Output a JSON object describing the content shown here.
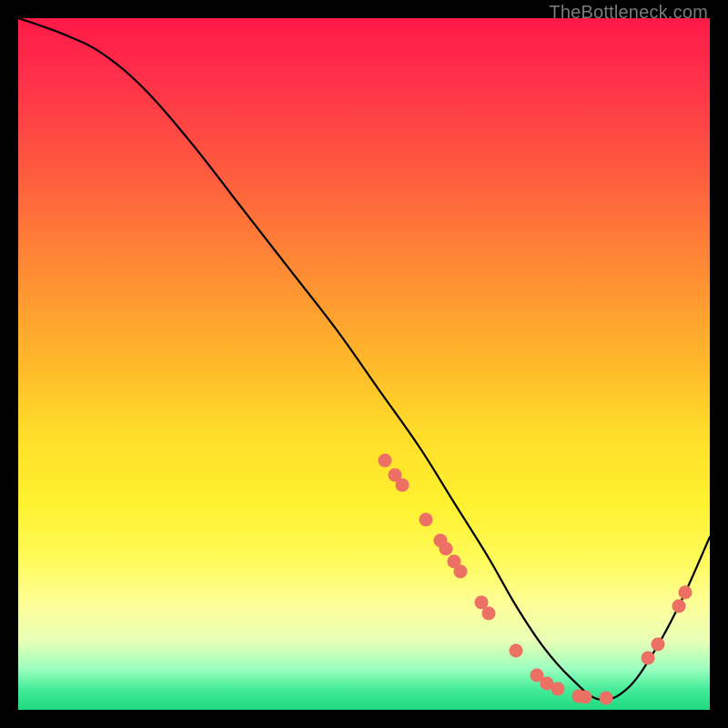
{
  "attribution": "TheBottleneck.com",
  "chart_data": {
    "type": "line",
    "title": "",
    "xlabel": "",
    "ylabel": "",
    "xlim": [
      0,
      100
    ],
    "ylim": [
      0,
      100
    ],
    "series": [
      {
        "name": "bottleneck-curve",
        "x": [
          0,
          3,
          7,
          12,
          18,
          25,
          32,
          39,
          46,
          52,
          58,
          63,
          68,
          72,
          76,
          80,
          84,
          88,
          92,
          96,
          100
        ],
        "y": [
          100,
          99,
          97.5,
          95,
          90,
          82,
          73,
          64,
          55,
          46.5,
          38,
          30,
          22,
          15,
          9,
          4.5,
          1.5,
          3,
          8.5,
          16,
          25
        ]
      }
    ],
    "points": {
      "name": "highlighted-points",
      "color": "#ec7063",
      "coords": [
        {
          "x": 53,
          "y": 36
        },
        {
          "x": 54.5,
          "y": 34
        },
        {
          "x": 55.5,
          "y": 32.5
        },
        {
          "x": 59,
          "y": 27.5
        },
        {
          "x": 61,
          "y": 24.5
        },
        {
          "x": 61.8,
          "y": 23.3
        },
        {
          "x": 63,
          "y": 21.5
        },
        {
          "x": 64,
          "y": 20
        },
        {
          "x": 67,
          "y": 15.5
        },
        {
          "x": 68,
          "y": 14
        },
        {
          "x": 72,
          "y": 8.5
        },
        {
          "x": 75,
          "y": 5
        },
        {
          "x": 76.5,
          "y": 3.8
        },
        {
          "x": 78,
          "y": 3
        },
        {
          "x": 81,
          "y": 2
        },
        {
          "x": 82,
          "y": 1.8
        },
        {
          "x": 85,
          "y": 1.7
        },
        {
          "x": 91,
          "y": 7.5
        },
        {
          "x": 92.5,
          "y": 9.5
        },
        {
          "x": 95.5,
          "y": 15
        },
        {
          "x": 96.5,
          "y": 17
        }
      ]
    },
    "background": {
      "type": "vertical-gradient",
      "stops": [
        {
          "pos": 0,
          "color": "#ff1a48"
        },
        {
          "pos": 50,
          "color": "#ffb92a"
        },
        {
          "pos": 80,
          "color": "#fffb58"
        },
        {
          "pos": 100,
          "color": "#1ed97f"
        }
      ]
    }
  }
}
